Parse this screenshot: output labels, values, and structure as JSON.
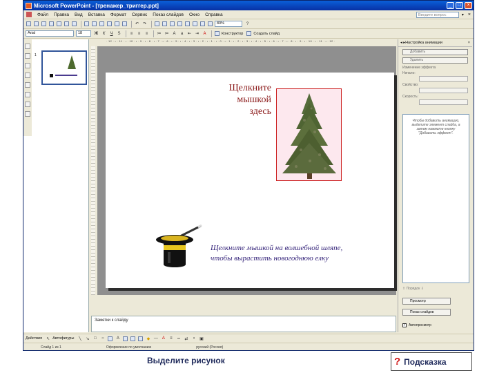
{
  "window": {
    "title": "Microsoft PowerPoint - [тренажер_триггер.ppt]",
    "minimize": "_",
    "maximize": "□",
    "close": "×"
  },
  "menubar": {
    "items": [
      "Файл",
      "Правка",
      "Вид",
      "Вставка",
      "Формат",
      "Сервис",
      "Показ слайдов",
      "Окно",
      "Справка"
    ],
    "help_placeholder": "Введите вопрос"
  },
  "toolbar1": {
    "zoom": "80%"
  },
  "toolbar2": {
    "font": "Arial",
    "size": "18",
    "design_label": "Конструктор",
    "new_slide_label": "Создать слайд"
  },
  "ruler": {
    "text": "· 12 · ı · 11 · ı · 10 · ı · 9 · ı · 8 · ı · 7 · ı · 6 · ı · 5 · ı · 4 · ı · 3 · ı · 2 · ı · 1 · ı · 0 · ı · 1 · ı · 2 · ı · 3 · ı · 4 · ı · 5 · ı · 6 · ı · 7 · ı · 8 · ı · 9 · ı · 10 · ı · 11 · ı · 12 ·"
  },
  "thumbnails": {
    "number": "1"
  },
  "slide": {
    "placeholder_line1": "Щелкните",
    "placeholder_line2": "мышкой",
    "placeholder_line3": "здесь",
    "instruction_line1": "Щелкните мышкой на волшебной шляпе,",
    "instruction_line2": "чтобы вырастить новогоднюю елку"
  },
  "notes": {
    "placeholder": "Заметки к слайду"
  },
  "taskpane": {
    "title": "Настройка анимации",
    "add_effect": "Добавить",
    "remove": "Удалить",
    "change_effect_label": "Изменение эффекта",
    "start_label": "Начало:",
    "property_label": "Свойство:",
    "speed_label": "Скорость:",
    "list_hint": "Чтобы добавить анимацию, выделите элемент слайда, а затем нажмите кнопку \"Добавить эффект\".",
    "reorder_label": "Порядок",
    "play_button": "Просмотр",
    "slideshow_button": "Показ слайдов",
    "autopreview_label": "Автопросмотр"
  },
  "drawbar": {
    "actions_label": "Действия",
    "autoshapes_label": "Автофигуры"
  },
  "statusbar": {
    "slide_info": "Слайд 1 из 1",
    "design": "Оформление по умолчанию",
    "language": "русский (Россия)"
  },
  "caption": {
    "instruction": "Выделите рисунок",
    "hint_icon": "?",
    "hint_label": "Подсказка"
  },
  "colors": {
    "titlebar": "#0a5fd8",
    "placeholder_text": "#8b1a1a",
    "instruction_text": "#35247a",
    "frame_border": "#cc1f1f",
    "frame_fill": "#fde8ee"
  }
}
